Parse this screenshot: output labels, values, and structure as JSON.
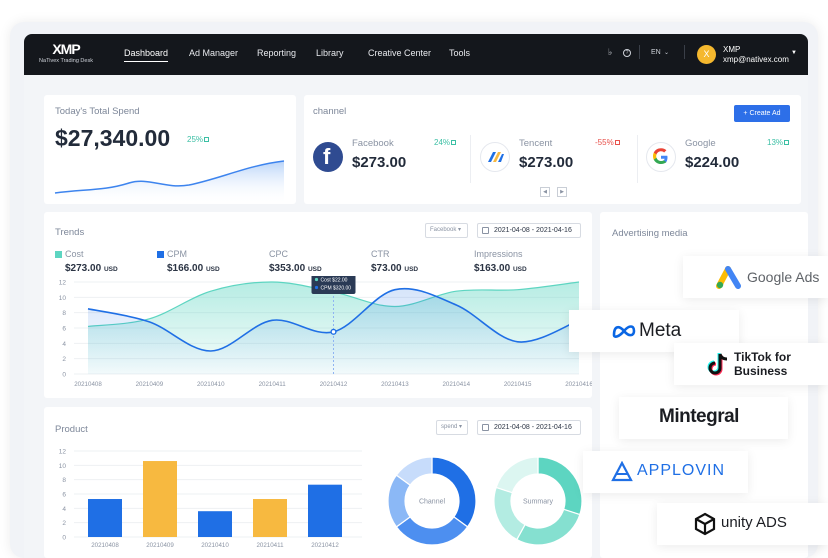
{
  "nav": {
    "logo": "XMP",
    "logo_sub": "NaTivex Trading Desk",
    "items": [
      "Dashboard",
      "Ad Manager",
      "Reporting",
      "Library",
      "Creative Center",
      "Tools"
    ],
    "lang": "EN",
    "user_initial": "X",
    "user_name": "XMP",
    "user_email": "xmp@nativex.com"
  },
  "spend": {
    "title": "Today's Total Spend",
    "value": "$27,340.00",
    "change": "25%"
  },
  "channel": {
    "title": "channel",
    "create_label": "+ Create Ad",
    "items": [
      {
        "name": "Facebook",
        "value": "$273.00",
        "change": "24%",
        "direction": "up"
      },
      {
        "name": "Tencent",
        "value": "$273.00",
        "change": "-55%",
        "direction": "down"
      },
      {
        "name": "Google",
        "value": "$224.00",
        "change": "13%",
        "direction": "up"
      }
    ]
  },
  "trends": {
    "title": "Trends",
    "filter": "Facebook",
    "date_range": "2021-04-08 - 2021-04-16",
    "metrics": [
      {
        "label": "Cost",
        "value": "$273.00",
        "unit": "USD",
        "color": "#5dd5c1"
      },
      {
        "label": "CPM",
        "value": "$166.00",
        "unit": "USD",
        "color": "#1f6fe5"
      },
      {
        "label": "CPC",
        "value": "$353.00",
        "unit": "USD",
        "color": ""
      },
      {
        "label": "CTR",
        "value": "$73.00",
        "unit": "USD",
        "color": ""
      },
      {
        "label": "Impressions",
        "value": "$163.00",
        "unit": "USD",
        "color": ""
      }
    ],
    "tooltip": {
      "cost": "Cost $22.00",
      "cpm": "CPM $320.00"
    }
  },
  "product": {
    "title": "Product",
    "filter": "spend",
    "date_range": "2021-04-08 - 2021-04-16",
    "donut_labels": [
      "Channel",
      "Summary"
    ]
  },
  "ad_media": {
    "title": "Advertising media",
    "partners": [
      "Google Ads",
      "Meta",
      "TikTok for Business",
      "Mintegral",
      "APPLOVIN",
      "unity ADS"
    ]
  },
  "chart_data": [
    {
      "type": "line",
      "title": "Trends",
      "x": [
        "20210408",
        "20210409",
        "20210410",
        "20210411",
        "20210412",
        "20210413",
        "20210414",
        "20210415",
        "20210416"
      ],
      "ylim": [
        0,
        12
      ],
      "yticks": [
        0,
        2,
        4,
        6,
        8,
        10,
        12
      ],
      "series": [
        {
          "name": "Cost",
          "color": "#5dd5c1",
          "values": [
            6.2,
            7.2,
            10.8,
            13.5,
            10.7,
            8.8,
            10.8,
            11.0,
            13.0
          ]
        },
        {
          "name": "CPM",
          "color": "#1f6fe5",
          "values": [
            8.5,
            6.8,
            3.0,
            7.0,
            5.5,
            11.0,
            9.0,
            4.2,
            7.0
          ]
        }
      ],
      "grid": true
    },
    {
      "type": "bar",
      "title": "Product",
      "categories": [
        "20210408",
        "20210409",
        "20210410",
        "20210411",
        "20210412"
      ],
      "values": [
        5.3,
        10.6,
        3.6,
        5.3,
        7.3
      ],
      "colors": [
        "#1f6fe5",
        "#f7b940",
        "#1f6fe5",
        "#f7b940",
        "#1f6fe5"
      ],
      "ylim": [
        0,
        12
      ],
      "yticks": [
        0,
        2,
        4,
        6,
        8,
        10,
        12
      ],
      "grid": true
    },
    {
      "type": "pie",
      "title": "Channel",
      "values": [
        35,
        30,
        20,
        15
      ],
      "colors": [
        "#1f6fe5",
        "#4d8ff0",
        "#8bb8f6",
        "#c7dcfb"
      ]
    },
    {
      "type": "pie",
      "title": "Summary",
      "values": [
        30,
        28,
        22,
        20
      ],
      "colors": [
        "#5dd5c1",
        "#85e0d0",
        "#b3ece2",
        "#dcf6f1"
      ]
    }
  ]
}
